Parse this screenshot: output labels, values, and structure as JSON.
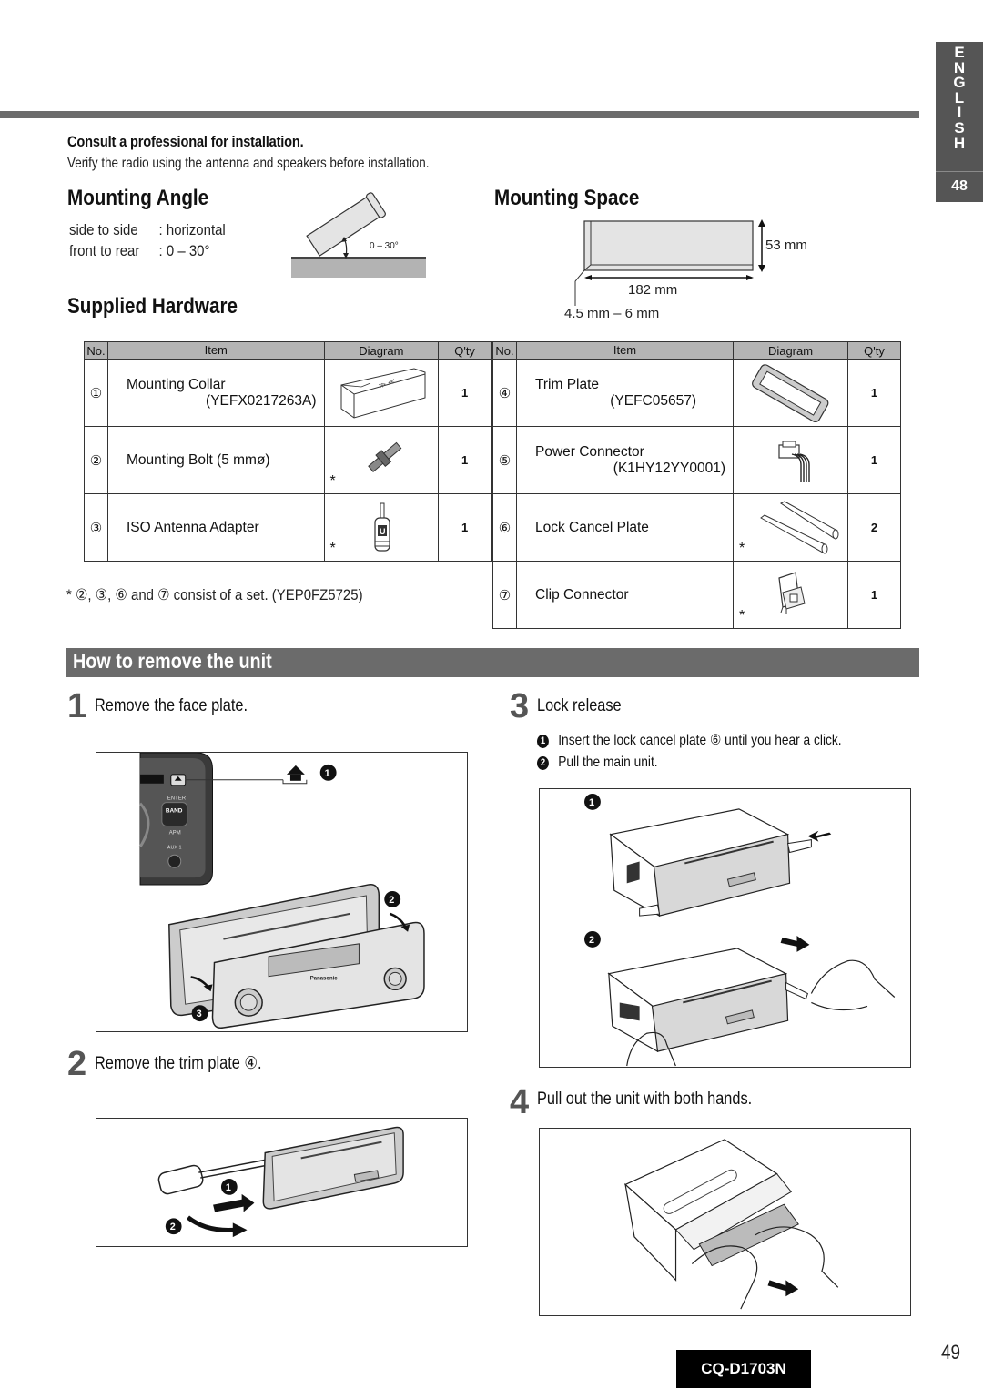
{
  "side_tab": {
    "letters": [
      "E",
      "N",
      "G",
      "L",
      "I",
      "S",
      "H"
    ],
    "page": "48"
  },
  "intro": {
    "title": "Consult a professional for installation.",
    "text": "Verify the radio using the antenna and speakers before installation."
  },
  "mounting_angle": {
    "title": "Mounting Angle",
    "specs": [
      {
        "label": "side to side",
        "value": ": horizontal"
      },
      {
        "label": "front to rear",
        "value": ": 0 – 30°"
      }
    ],
    "figure_label": "0 – 30°"
  },
  "mounting_space": {
    "title": "Mounting Space",
    "height": "53 mm",
    "width": "182 mm",
    "thickness": "4.5 mm – 6 mm"
  },
  "supplied_hardware": {
    "title": "Supplied Hardware",
    "headers": {
      "no": "No.",
      "item": "Item",
      "diagram": "Diagram",
      "qty": "Q'ty"
    },
    "items": [
      {
        "no": "①",
        "name": "Mounting Collar",
        "code": "(YEFX0217263A)",
        "qty": "1",
        "set": false,
        "icon": "mounting-collar"
      },
      {
        "no": "②",
        "name": "Mounting Bolt (5 mmø)",
        "code": "",
        "qty": "1",
        "set": true,
        "icon": "mounting-bolt"
      },
      {
        "no": "③",
        "name": "ISO Antenna Adapter",
        "code": "",
        "qty": "1",
        "set": true,
        "icon": "antenna-adapter"
      },
      {
        "no": "④",
        "name": "Trim Plate",
        "code": "(YEFC05657)",
        "qty": "1",
        "set": false,
        "icon": "trim-plate"
      },
      {
        "no": "⑤",
        "name": "Power Connector",
        "code": "(K1HY12YY0001)",
        "qty": "1",
        "set": false,
        "icon": "power-connector"
      },
      {
        "no": "⑥",
        "name": "Lock Cancel Plate",
        "code": "",
        "qty": "2",
        "set": true,
        "icon": "lock-cancel-plate"
      },
      {
        "no": "⑦",
        "name": "Clip Connector",
        "code": "",
        "qty": "1",
        "set": true,
        "icon": "clip-connector"
      }
    ],
    "asterisk": "*",
    "footnote": "* ②, ③, ⑥ and ⑦ consist of a set. (YEP0FZ5725)"
  },
  "remove_unit": {
    "title": "How to remove the unit",
    "steps": [
      {
        "num": "1",
        "text": "Remove the face plate."
      },
      {
        "num": "2",
        "text": "Remove the trim plate ④."
      },
      {
        "num": "3",
        "text": "Lock release",
        "substeps": [
          {
            "bullet": "1",
            "text": "Insert the lock cancel plate ⑥ until you hear a click."
          },
          {
            "bullet": "2",
            "text": "Pull the main unit."
          }
        ]
      },
      {
        "num": "4",
        "text": "Pull out the unit with both hands."
      }
    ],
    "fig_labels": {
      "fig1": [
        "1",
        "2",
        "3"
      ],
      "fig1_panel": [
        "ENTER",
        "BAND",
        "APM",
        "AUX 1",
        "Panasonic"
      ],
      "fig2": [
        "1",
        "2"
      ],
      "fig3": [
        "1",
        "2"
      ]
    }
  },
  "footer": {
    "model": "CQ-D1703N",
    "page": "49"
  }
}
